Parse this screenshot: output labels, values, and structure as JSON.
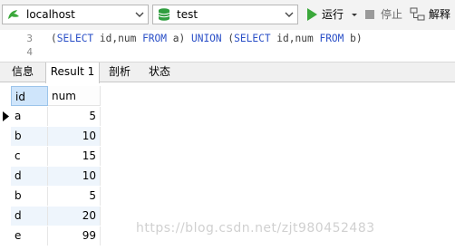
{
  "toolbar": {
    "connection": "localhost",
    "database": "test",
    "run_label": "运行",
    "stop_label": "停止",
    "explain_label": "解释"
  },
  "editor": {
    "line_numbers": [
      "3",
      "4"
    ],
    "code_prefix": "(",
    "kw_select_1": "SELECT",
    "cols_1": " id,num ",
    "kw_from_1": "FROM",
    "table_1": " a) ",
    "kw_union": "UNION",
    "mid": " (",
    "kw_select_2": "SELECT",
    "cols_2": " id,num ",
    "kw_from_2": "FROM",
    "table_2": " b)"
  },
  "tabs": [
    {
      "label": "信息"
    },
    {
      "label": "Result 1"
    },
    {
      "label": "剖析"
    },
    {
      "label": "状态"
    }
  ],
  "grid": {
    "columns": [
      "id",
      "num"
    ],
    "rows": [
      {
        "id": "a",
        "num": "5"
      },
      {
        "id": "b",
        "num": "10"
      },
      {
        "id": "c",
        "num": "15"
      },
      {
        "id": "d",
        "num": "10"
      },
      {
        "id": "b",
        "num": "5"
      },
      {
        "id": "d",
        "num": "20"
      },
      {
        "id": "e",
        "num": "99"
      }
    ]
  },
  "watermark": "https://blog.csdn.net/zjt980452483",
  "colors": {
    "keyword": "#2b50c7",
    "run_green": "#3aa83a",
    "db_green": "#2f9e3f",
    "selected_header": "#cfe5fb",
    "alt_row": "#eef5fc"
  }
}
